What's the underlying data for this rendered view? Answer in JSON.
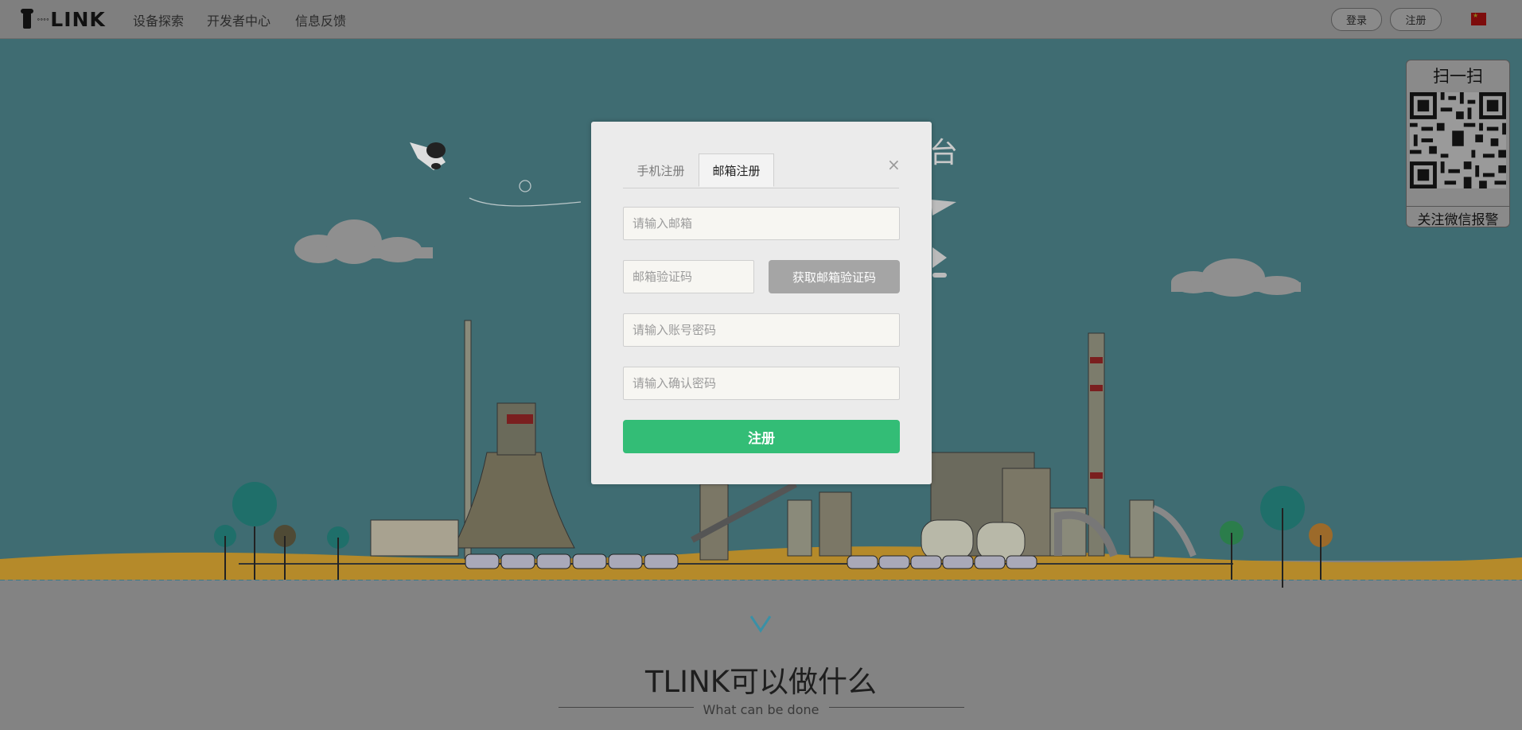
{
  "nav": {
    "logo_text": "LINK",
    "logo_dots": "∘∘∘∘",
    "links": [
      "设备探索",
      "开发者中心",
      "信息反馈"
    ],
    "login_label": "登录",
    "register_label": "注册"
  },
  "modal": {
    "tabs": [
      "手机注册",
      "邮箱注册"
    ],
    "active_tab": "邮箱注册",
    "close_label": "×",
    "email_placeholder": "请输入邮箱",
    "code_placeholder": "邮箱验证码",
    "get_code_label": "获取邮箱验证码",
    "password_placeholder": "请输入账号密码",
    "confirm_placeholder": "请输入确认密码",
    "submit_label": "注册"
  },
  "qr": {
    "title": "扫一扫",
    "caption": "关注微信报警"
  },
  "section": {
    "title": "TLINK可以做什么",
    "subtitle": "What can be done"
  },
  "colors": {
    "hero_bg": "#3f6c72",
    "overlay": "#888888",
    "submit_green": "#33bd76"
  },
  "icons": [
    "china-flag-icon",
    "close-icon",
    "chevron-down-icon",
    "qr-code-icon"
  ]
}
